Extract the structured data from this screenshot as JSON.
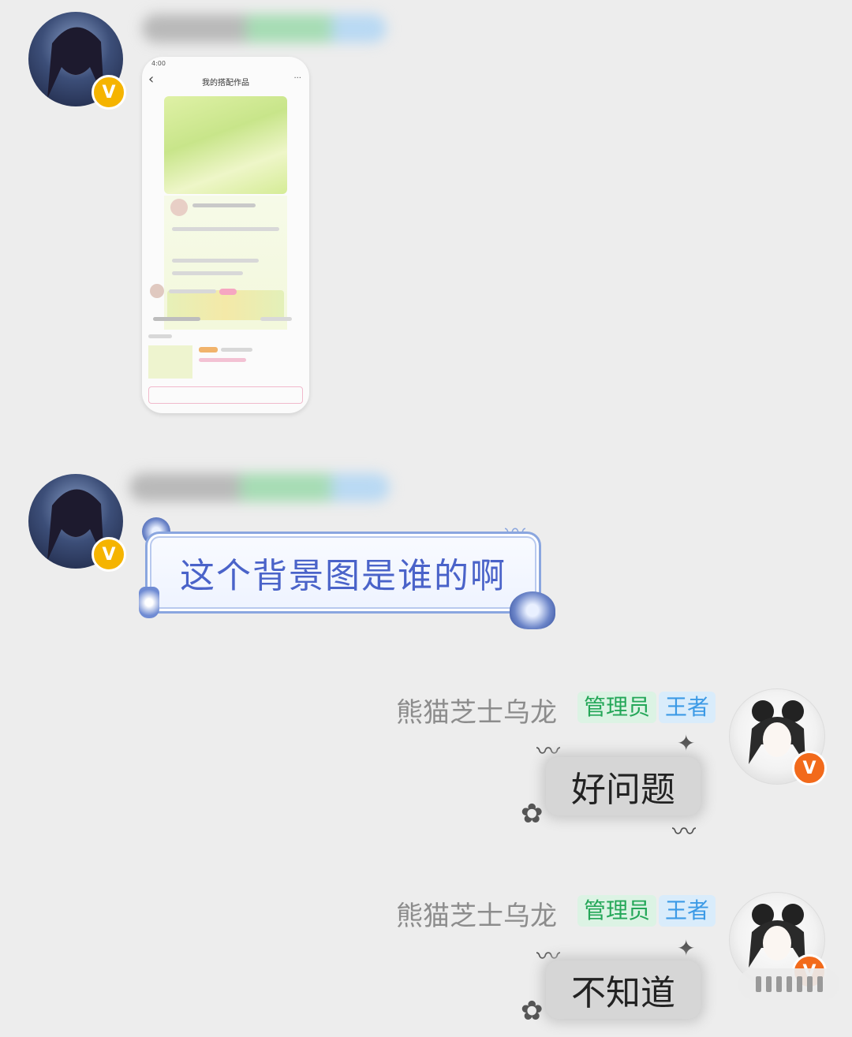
{
  "messages": [
    {
      "type": "image",
      "side": "left",
      "badge_color": "#f5b400",
      "screenshot": {
        "status_time": "4:00",
        "title": "我的搭配作品",
        "menu": "···"
      }
    },
    {
      "type": "text",
      "side": "left",
      "badge_color": "#f5b400",
      "text": "这个背景图是谁的啊",
      "text_color": "#4a63c9"
    },
    {
      "type": "text",
      "side": "right",
      "badge_color": "#f26a1b",
      "sender": "熊猫芝士乌龙",
      "tags": [
        {
          "label": "管理员",
          "color": "#24a758"
        },
        {
          "label": "王者",
          "color": "#3c9ae6"
        }
      ],
      "text": "好问题"
    },
    {
      "type": "text",
      "side": "right",
      "badge_color": "#f26a1b",
      "sender": "熊猫芝士乌龙",
      "tags": [
        {
          "label": "管理员",
          "color": "#24a758"
        },
        {
          "label": "王者",
          "color": "#3c9ae6"
        }
      ],
      "text": "不知道"
    }
  ],
  "icons": {
    "verified": "V",
    "back": "‹",
    "ink": "〰"
  }
}
